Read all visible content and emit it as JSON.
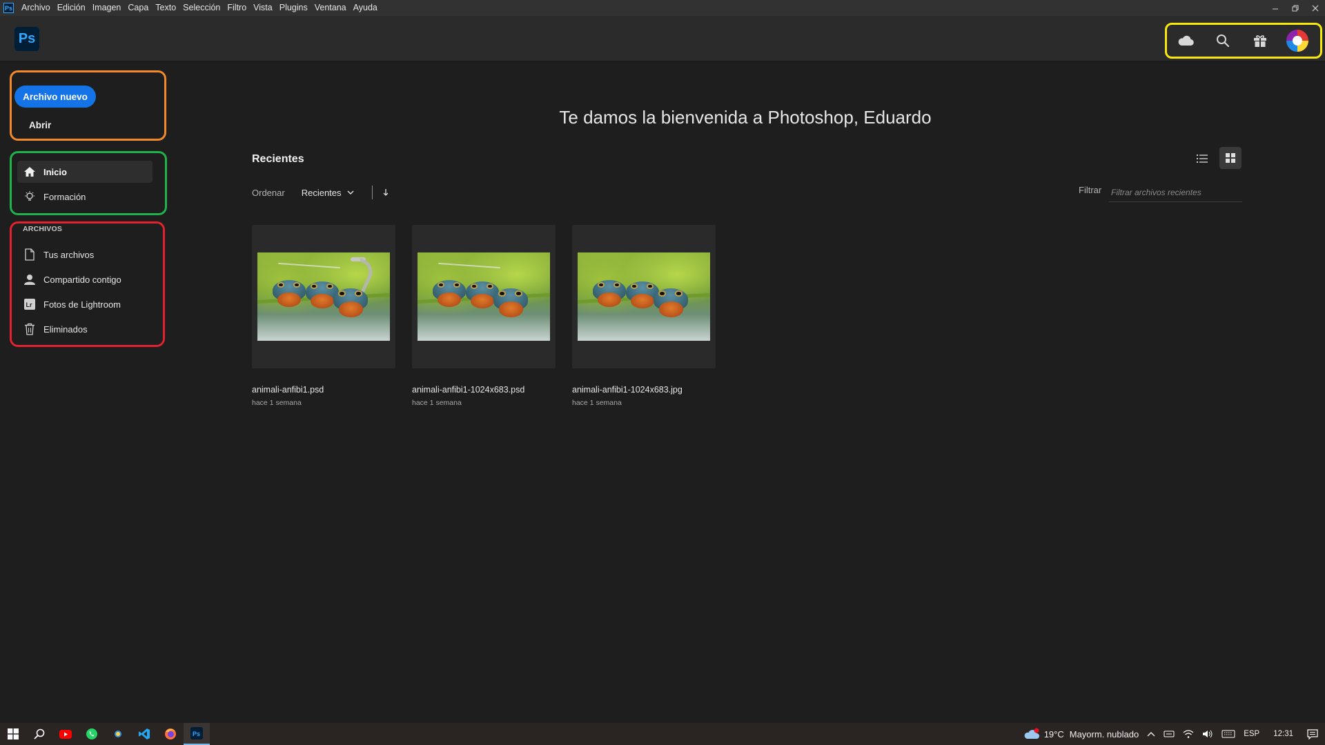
{
  "menubar": {
    "app_icon": "Ps",
    "items": [
      "Archivo",
      "Edición",
      "Imagen",
      "Capa",
      "Texto",
      "Selección",
      "Filtro",
      "Vista",
      "Plugins",
      "Ventana",
      "Ayuda"
    ]
  },
  "header": {
    "logo": "Ps",
    "tools": [
      "cloud-icon",
      "search-icon",
      "gift-icon",
      "avatar"
    ]
  },
  "sidebar": {
    "new_file": "Archivo nuevo",
    "open": "Abrir",
    "nav": [
      {
        "label": "Inicio",
        "icon": "home-icon",
        "active": true
      },
      {
        "label": "Formación",
        "icon": "lightbulb-icon",
        "active": false
      }
    ],
    "files_section": "ARCHIVOS",
    "files": [
      {
        "label": "Tus archivos",
        "icon": "document-icon"
      },
      {
        "label": "Compartido contigo",
        "icon": "person-icon"
      },
      {
        "label": "Fotos de Lightroom",
        "icon": "lightroom-icon"
      },
      {
        "label": "Eliminados",
        "icon": "trash-icon"
      }
    ]
  },
  "main": {
    "welcome": "Te damos la bienvenida a Photoshop, Eduardo",
    "recent_title": "Recientes",
    "sort_label": "Ordenar",
    "sort_value": "Recientes",
    "filter_label": "Filtrar",
    "filter_placeholder": "Filtrar archivos recientes",
    "files": [
      {
        "name": "animali-anfibi1.psd",
        "date": "hace 1 semana"
      },
      {
        "name": "animali-anfibi1-1024x683.psd",
        "date": "hace 1 semana"
      },
      {
        "name": "animali-anfibi1-1024x683.jpg",
        "date": "hace 1 semana"
      }
    ]
  },
  "taskbar": {
    "weather_temp": "19°C",
    "weather_text": "Mayorm. nublado",
    "language": "ESP",
    "time": "12:31"
  },
  "colors": {
    "accent": "#1473e6",
    "ps_blue": "#31a8ff",
    "highlight_yellow": "#f7ea0b",
    "highlight_orange": "#f28a2a",
    "highlight_green": "#1fb34a",
    "highlight_red": "#e3222f"
  }
}
